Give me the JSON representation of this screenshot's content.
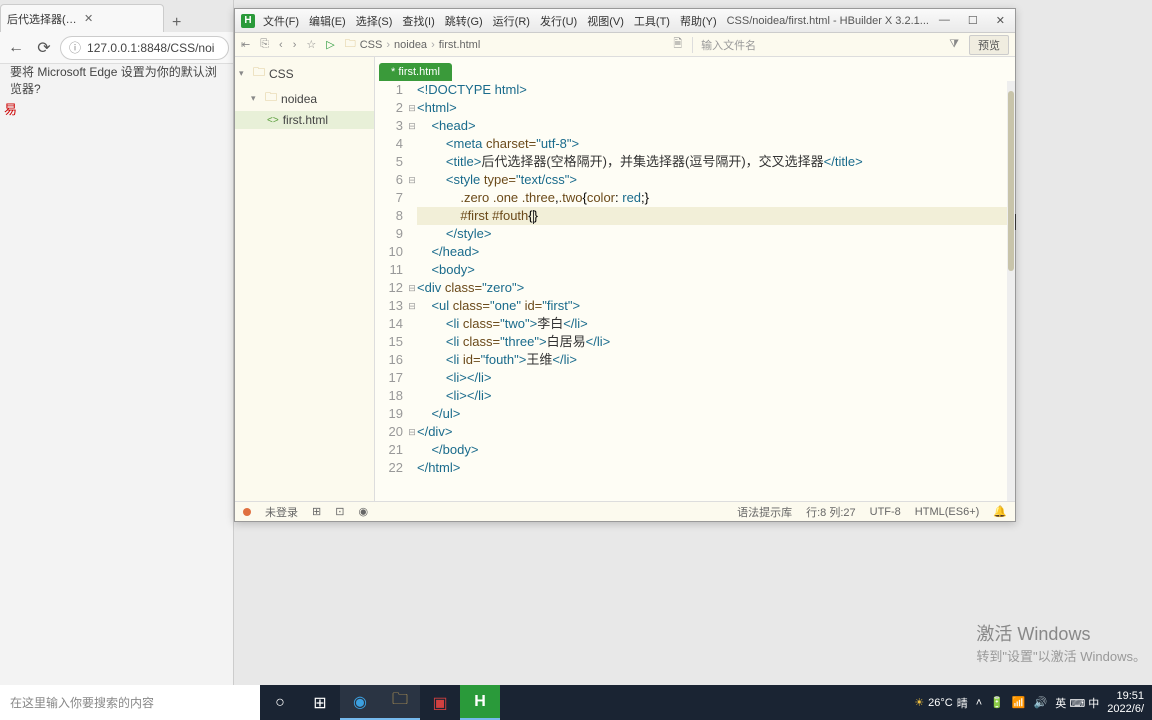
{
  "browser": {
    "tab_title": "后代选择器(空格隔开)，并集选择",
    "url": "127.0.0.1:8848/CSS/noi",
    "infobar": "要将 Microsoft Edge 设置为你的默认浏览器?",
    "content_line": "易"
  },
  "hbuilder": {
    "menus": [
      "文件(F)",
      "编辑(E)",
      "选择(S)",
      "查找(I)",
      "跳转(G)",
      "运行(R)",
      "发行(U)",
      "视图(V)",
      "工具(T)",
      "帮助(Y)"
    ],
    "title": "CSS/noidea/first.html - HBuilder X 3.2.1...",
    "breadcrumb": [
      "CSS",
      "noidea",
      "first.html"
    ],
    "input_file_placeholder": "输入文件名",
    "preview": "预览",
    "tree": {
      "root": "CSS",
      "folder": "noidea",
      "file": "first.html"
    },
    "tab": "* first.html",
    "code": [
      {
        "n": 1,
        "html": "<span class='tag'>&lt;!DOCTYPE html&gt;</span>"
      },
      {
        "n": 2,
        "html": "<span class='tag'>&lt;html&gt;</span>"
      },
      {
        "n": 3,
        "html": "    <span class='tag'>&lt;head&gt;</span>"
      },
      {
        "n": 4,
        "html": "        <span class='tag'>&lt;meta</span> <span class='attr'>charset=</span><span class='str'>\"utf-8\"</span><span class='tag'>&gt;</span>"
      },
      {
        "n": 5,
        "html": "        <span class='tag'>&lt;title&gt;</span><span class='txt'>后代选择器(空格隔开)，并集选择器(逗号隔开)，交叉选择器</span><span class='tag'>&lt;/title&gt;</span>"
      },
      {
        "n": 6,
        "html": "        <span class='tag'>&lt;style</span> <span class='attr'>type=</span><span class='str'>\"text/css\"</span><span class='tag'>&gt;</span>"
      },
      {
        "n": 7,
        "html": "            <span class='sel'>.zero .one .three</span>,<span class='sel'>.two</span>{<span class='prop'>color</span>: <span class='val'>red</span>;}"
      },
      {
        "n": 8,
        "html": "            <span class='sel'>#first #fouth</span>{<span class='cursor-caret'></span>}",
        "hl": true
      },
      {
        "n": 9,
        "html": "        <span class='tag'>&lt;/style&gt;</span>"
      },
      {
        "n": 10,
        "html": "    <span class='tag'>&lt;/head&gt;</span>"
      },
      {
        "n": 11,
        "html": "    <span class='tag'>&lt;body&gt;</span>"
      },
      {
        "n": 12,
        "html": "<span class='tag'>&lt;div</span> <span class='attr'>class=</span><span class='str'>\"zero\"</span><span class='tag'>&gt;</span>"
      },
      {
        "n": 13,
        "html": "    <span class='tag'>&lt;ul</span> <span class='attr'>class=</span><span class='str'>\"one\"</span> <span class='attr'>id=</span><span class='str'>\"first\"</span><span class='tag'>&gt;</span>"
      },
      {
        "n": 14,
        "html": "        <span class='tag'>&lt;li</span> <span class='attr'>class=</span><span class='str'>\"two\"</span><span class='tag'>&gt;</span><span class='txt'>李白</span><span class='tag'>&lt;/li&gt;</span>"
      },
      {
        "n": 15,
        "html": "        <span class='tag'>&lt;li</span> <span class='attr'>class=</span><span class='str'>\"three\"</span><span class='tag'>&gt;</span><span class='txt'>白居易</span><span class='tag'>&lt;/li&gt;</span>"
      },
      {
        "n": 16,
        "html": "        <span class='tag'>&lt;li</span> <span class='attr'>id=</span><span class='str'>\"fouth\"</span><span class='tag'>&gt;</span><span class='txt'>王维</span><span class='tag'>&lt;/li&gt;</span>"
      },
      {
        "n": 17,
        "html": "        <span class='tag'>&lt;li&gt;&lt;/li&gt;</span>"
      },
      {
        "n": 18,
        "html": "        <span class='tag'>&lt;li&gt;&lt;/li&gt;</span>"
      },
      {
        "n": 19,
        "html": "    <span class='tag'>&lt;/ul&gt;</span>"
      },
      {
        "n": 20,
        "html": "<span class='tag'>&lt;/div&gt;</span>"
      },
      {
        "n": 21,
        "html": "    <span class='tag'>&lt;/body&gt;</span>"
      },
      {
        "n": 22,
        "html": "<span class='tag'>&lt;/html&gt;</span>"
      }
    ],
    "fold": {
      "2": "⊟",
      "3": "⊟",
      "6": "⊟",
      "12": "⊟",
      "13": "⊟",
      "20": "⊟"
    },
    "status": {
      "login": "未登录",
      "hint": "语法提示库",
      "pos": "行:8 列:27",
      "enc": "UTF-8",
      "lang": "HTML(ES6+)"
    }
  },
  "watermark": {
    "big": "激活 Windows",
    "small": "转到\"设置\"以激活 Windows。"
  },
  "taskbar": {
    "search_placeholder": "在这里输入你要搜索的内容",
    "weather_temp": "26°C",
    "weather_cond": "晴",
    "ime": "英 ⌨ 中",
    "time": "19:51",
    "date": "2022/6/"
  }
}
